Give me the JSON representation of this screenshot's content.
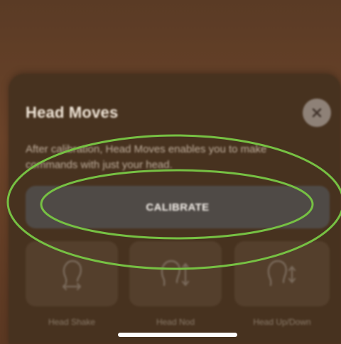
{
  "panel": {
    "title": "Head Moves",
    "description": "After calibration, Head Moves enables you to make commands with just your head.",
    "close_icon": "close-icon"
  },
  "calibrate_button": {
    "label": "CALIBRATE"
  },
  "moves": [
    {
      "label": "Head Shake",
      "icon": "head-shake-icon"
    },
    {
      "label": "Head Nod",
      "icon": "head-nod-icon"
    },
    {
      "label": "Head Up/Down",
      "icon": "head-up-down-icon"
    }
  ],
  "annotation": {
    "color": "#76c043"
  }
}
